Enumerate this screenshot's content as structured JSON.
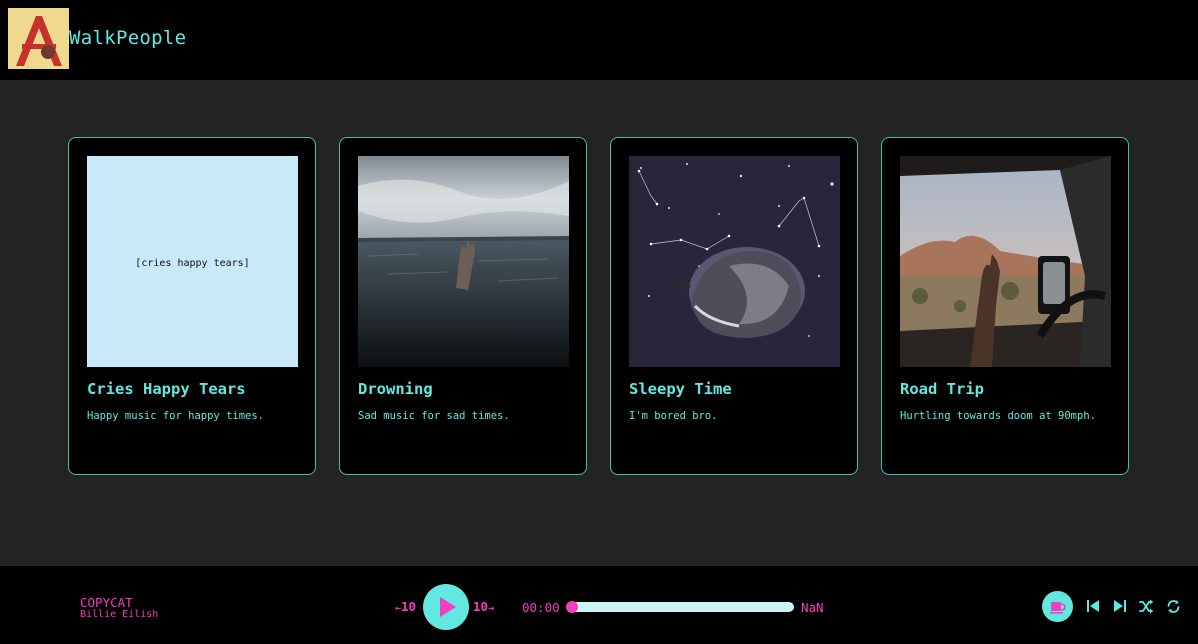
{
  "header": {
    "brand": "WalkPeople"
  },
  "playlists": [
    {
      "title": "Cries Happy Tears",
      "description": "Happy music for happy times.",
      "art_text": "[cries happy tears]"
    },
    {
      "title": "Drowning",
      "description": "Sad music for sad times."
    },
    {
      "title": "Sleepy Time",
      "description": "I'm bored bro."
    },
    {
      "title": "Road Trip",
      "description": "Hurtling towards doom at 90mph."
    }
  ],
  "player": {
    "track_title": "COPYCAT",
    "artist": "Billie Eilish",
    "rewind_label": "10",
    "forward_label": "10",
    "current_time": "00:00",
    "duration": "NaN",
    "progress": 0
  },
  "colors": {
    "accent_cyan": "#61e8e1",
    "accent_pink": "#f43fbd",
    "background": "#232323",
    "bar": "#000000"
  },
  "icons": {
    "logo": "react-atom-icon",
    "play": "play-icon",
    "coffee": "coffee-icon",
    "previous": "skip-back-icon",
    "next": "skip-forward-icon",
    "shuffle": "shuffle-icon",
    "repeat": "repeat-icon"
  }
}
